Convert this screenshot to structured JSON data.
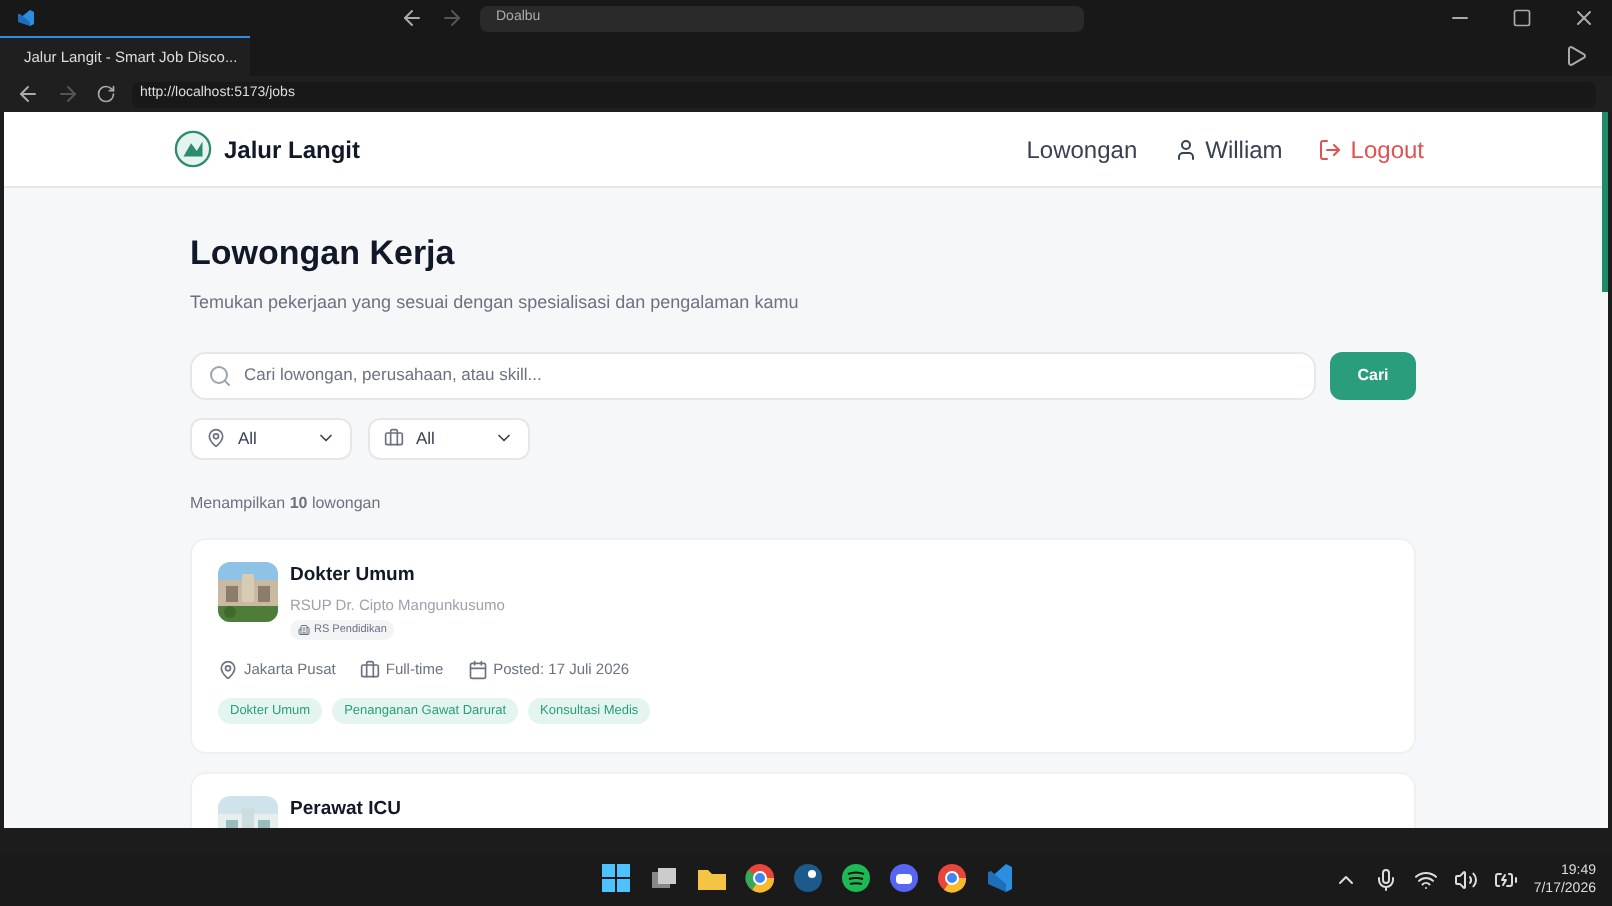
{
  "browser": {
    "command_text": "Doalbu",
    "tab": {
      "title": "Jalur Langit - Smart Job Disco...",
      "selected": true
    },
    "url": "http://localhost:5173/jobs"
  },
  "header": {
    "brand": "Jalur Langit",
    "nav": [
      {
        "kind": "link",
        "label": "Lowongan"
      },
      {
        "kind": "user",
        "label": "William"
      },
      {
        "kind": "logout",
        "label": "Logout"
      }
    ]
  },
  "page": {
    "title": "Lowongan Kerja",
    "subtitle": "Temukan pekerjaan yang sesuai dengan spesialisasi dan pengalaman kamu",
    "search": {
      "placeholder": "Cari lowongan, perusahaan, atau skill..."
    },
    "search_button": "Cari",
    "filters": [
      {
        "kind": "location",
        "value": "All"
      },
      {
        "kind": "type",
        "value": "All"
      }
    ],
    "count": "Menampilkan **10** lowongan",
    "jobs": [
      {
        "title": "Dokter Umum",
        "company": "RSUP Dr. Cipto Mangunkusumo",
        "badge": "RS Pendidikan",
        "location": "Jakarta Pusat",
        "type": "Full-time",
        "posted": "Posted: 17 Juli 2026",
        "tags": [
          "Dokter Umum",
          "Penanganan Gawat Darurat",
          "Konsultasi Medis"
        ]
      },
      {
        "title": "Perawat ICU"
      }
    ]
  },
  "taskbar": {
    "time": "19:49",
    "date": "7/17/2026"
  }
}
